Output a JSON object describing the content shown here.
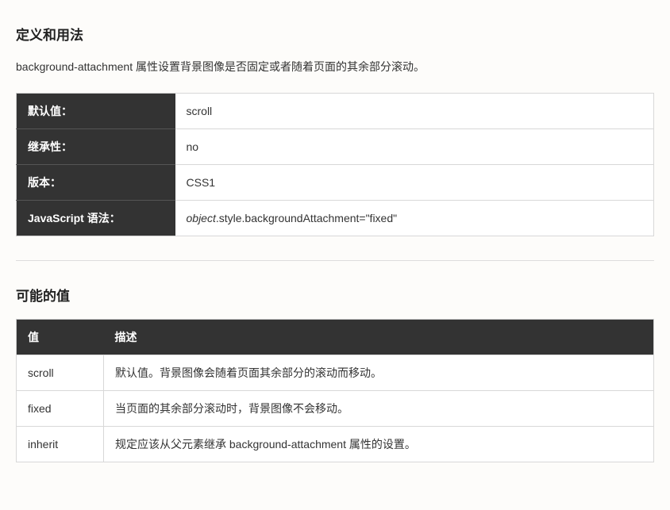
{
  "section1": {
    "heading": "定义和用法",
    "description": "background-attachment 属性设置背景图像是否固定或者随着页面的其余部分滚动。",
    "rows": [
      {
        "label": "默认值：",
        "value": "scroll"
      },
      {
        "label": "继承性：",
        "value": "no"
      },
      {
        "label": "版本：",
        "value": "CSS1"
      },
      {
        "label": "JavaScript 语法：",
        "value_prefix_italic": "object",
        "value_rest": ".style.backgroundAttachment=\"fixed\""
      }
    ]
  },
  "section2": {
    "heading": "可能的值",
    "headers": {
      "col1": "值",
      "col2": "描述"
    },
    "rows": [
      {
        "value": "scroll",
        "desc": "默认值。背景图像会随着页面其余部分的滚动而移动。"
      },
      {
        "value": "fixed",
        "desc": "当页面的其余部分滚动时，背景图像不会移动。"
      },
      {
        "value": "inherit",
        "desc": "规定应该从父元素继承 background-attachment 属性的设置。"
      }
    ]
  }
}
